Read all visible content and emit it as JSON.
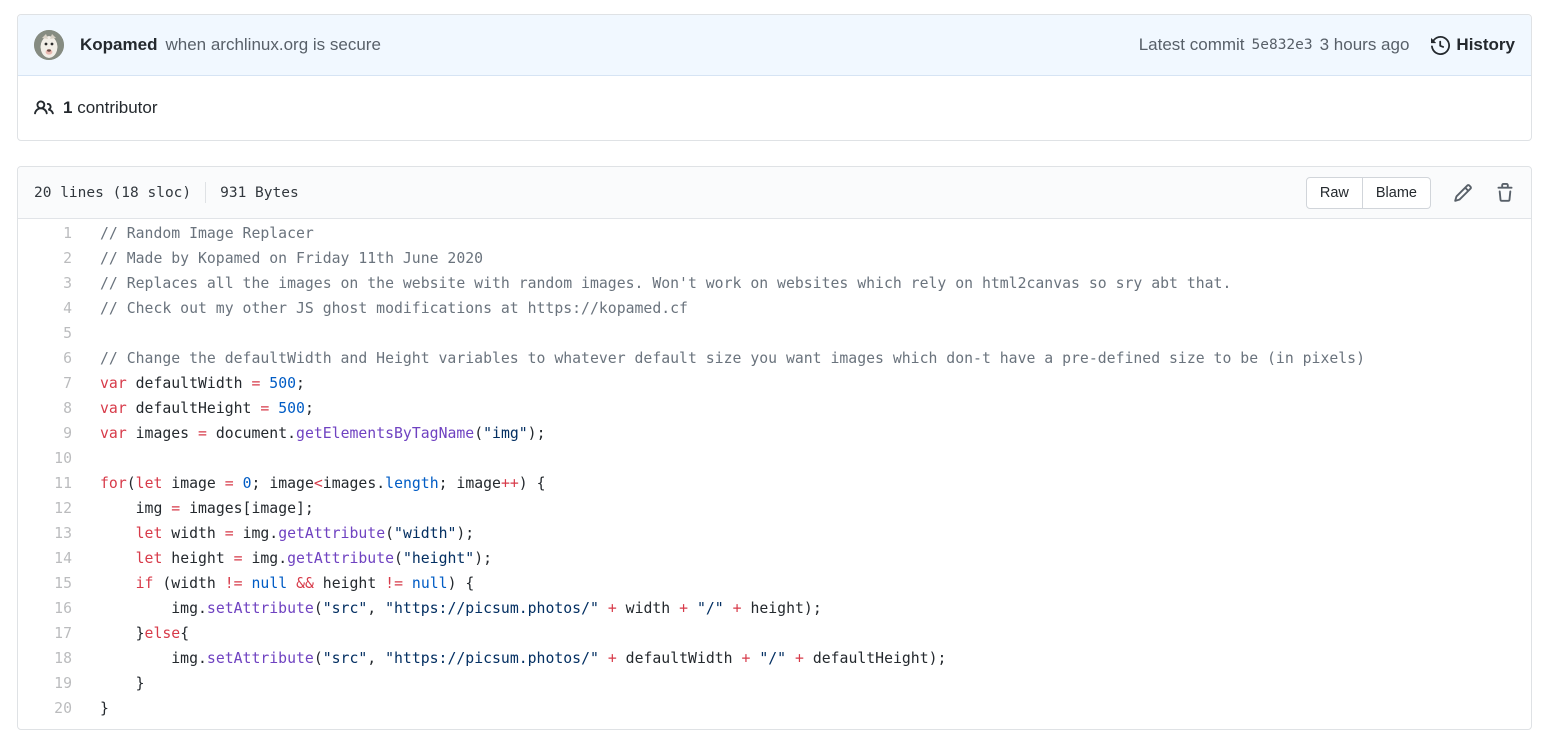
{
  "commit_header": {
    "author": "Kopamed",
    "message": "when archlinux.org is secure",
    "latest_commit_label": "Latest commit",
    "commit_hash": "5e832e3",
    "commit_time": "3 hours ago",
    "history_label": "History"
  },
  "contributors": {
    "count": "1",
    "label": "contributor"
  },
  "file_header": {
    "lines_info": "20 lines (18 sloc)",
    "size_info": "931 Bytes",
    "raw_label": "Raw",
    "blame_label": "Blame"
  },
  "icons": {
    "avatar": "dog-avatar",
    "people": "people-icon",
    "history": "history-clock-icon",
    "edit": "pencil-icon",
    "delete": "trash-icon"
  },
  "colors": {
    "commit_header_bg": "#f1f8ff",
    "file_header_bg": "#fafbfc",
    "border": "#dfe2e5",
    "text": "#24292e",
    "muted": "#586069",
    "syntax_comment": "#6a737d",
    "syntax_keyword": "#d73a49",
    "syntax_constant": "#005cc5",
    "syntax_function": "#6f42c1",
    "syntax_string": "#032f62"
  },
  "code": {
    "lines": [
      {
        "n": 1,
        "t": [
          [
            "// Random Image Replacer",
            "c"
          ]
        ]
      },
      {
        "n": 2,
        "t": [
          [
            "// Made by Kopamed on Friday 11th June 2020",
            "c"
          ]
        ]
      },
      {
        "n": 3,
        "t": [
          [
            "// Replaces all the images on the website with random images. Won't work on websites which rely on html2canvas so sry abt that.",
            "c"
          ]
        ]
      },
      {
        "n": 4,
        "t": [
          [
            "// Check out my other JS ghost modifications at https://kopamed.cf",
            "c"
          ]
        ]
      },
      {
        "n": 5,
        "t": []
      },
      {
        "n": 6,
        "t": [
          [
            "// Change the defaultWidth and Height variables to whatever default size you want images which don-t have a pre-defined size to be (in pixels)",
            "c"
          ]
        ]
      },
      {
        "n": 7,
        "t": [
          [
            "var",
            "k"
          ],
          [
            " defaultWidth ",
            ""
          ],
          [
            "=",
            "k"
          ],
          [
            " ",
            ""
          ],
          [
            "500",
            "n"
          ],
          [
            ";",
            ""
          ]
        ]
      },
      {
        "n": 8,
        "t": [
          [
            "var",
            "k"
          ],
          [
            " defaultHeight ",
            ""
          ],
          [
            "=",
            "k"
          ],
          [
            " ",
            ""
          ],
          [
            "500",
            "n"
          ],
          [
            ";",
            ""
          ]
        ]
      },
      {
        "n": 9,
        "t": [
          [
            "var",
            "k"
          ],
          [
            " images ",
            ""
          ],
          [
            "=",
            "k"
          ],
          [
            " document.",
            ""
          ],
          [
            "getElementsByTagName",
            "f"
          ],
          [
            "(",
            ""
          ],
          [
            "\"img\"",
            "s"
          ],
          [
            ");",
            ""
          ]
        ]
      },
      {
        "n": 10,
        "t": []
      },
      {
        "n": 11,
        "t": [
          [
            "for",
            "k"
          ],
          [
            "(",
            ""
          ],
          [
            "let",
            "k"
          ],
          [
            " image ",
            ""
          ],
          [
            "=",
            "k"
          ],
          [
            " ",
            ""
          ],
          [
            "0",
            "n"
          ],
          [
            "; image",
            ""
          ],
          [
            "<",
            "k"
          ],
          [
            "images.",
            ""
          ],
          [
            "length",
            "n"
          ],
          [
            "; image",
            ""
          ],
          [
            "++",
            "k"
          ],
          [
            ") {",
            ""
          ]
        ]
      },
      {
        "n": 12,
        "t": [
          [
            "    img ",
            ""
          ],
          [
            "=",
            "k"
          ],
          [
            " images[image];",
            ""
          ]
        ]
      },
      {
        "n": 13,
        "t": [
          [
            "    ",
            ""
          ],
          [
            "let",
            "k"
          ],
          [
            " width ",
            ""
          ],
          [
            "=",
            "k"
          ],
          [
            " img.",
            ""
          ],
          [
            "getAttribute",
            "f"
          ],
          [
            "(",
            ""
          ],
          [
            "\"width\"",
            "s"
          ],
          [
            ");",
            ""
          ]
        ]
      },
      {
        "n": 14,
        "t": [
          [
            "    ",
            ""
          ],
          [
            "let",
            "k"
          ],
          [
            " height ",
            ""
          ],
          [
            "=",
            "k"
          ],
          [
            " img.",
            ""
          ],
          [
            "getAttribute",
            "f"
          ],
          [
            "(",
            ""
          ],
          [
            "\"height\"",
            "s"
          ],
          [
            ");",
            ""
          ]
        ]
      },
      {
        "n": 15,
        "t": [
          [
            "    ",
            ""
          ],
          [
            "if",
            "k"
          ],
          [
            " (width ",
            ""
          ],
          [
            "!=",
            "k"
          ],
          [
            " ",
            ""
          ],
          [
            "null",
            "n"
          ],
          [
            " ",
            ""
          ],
          [
            "&&",
            "k"
          ],
          [
            " height ",
            ""
          ],
          [
            "!=",
            "k"
          ],
          [
            " ",
            ""
          ],
          [
            "null",
            "n"
          ],
          [
            ") {",
            ""
          ]
        ]
      },
      {
        "n": 16,
        "t": [
          [
            "        img.",
            ""
          ],
          [
            "setAttribute",
            "f"
          ],
          [
            "(",
            ""
          ],
          [
            "\"src\"",
            "s"
          ],
          [
            ", ",
            ""
          ],
          [
            "\"https://picsum.photos/\"",
            "s"
          ],
          [
            " ",
            ""
          ],
          [
            "+",
            "k"
          ],
          [
            " width ",
            ""
          ],
          [
            "+",
            "k"
          ],
          [
            " ",
            ""
          ],
          [
            "\"/\"",
            "s"
          ],
          [
            " ",
            ""
          ],
          [
            "+",
            "k"
          ],
          [
            " height);",
            ""
          ]
        ]
      },
      {
        "n": 17,
        "t": [
          [
            "    }",
            ""
          ],
          [
            "else",
            "k"
          ],
          [
            "{",
            ""
          ]
        ]
      },
      {
        "n": 18,
        "t": [
          [
            "        img.",
            ""
          ],
          [
            "setAttribute",
            "f"
          ],
          [
            "(",
            ""
          ],
          [
            "\"src\"",
            "s"
          ],
          [
            ", ",
            ""
          ],
          [
            "\"https://picsum.photos/\"",
            "s"
          ],
          [
            " ",
            ""
          ],
          [
            "+",
            "k"
          ],
          [
            " defaultWidth ",
            ""
          ],
          [
            "+",
            "k"
          ],
          [
            " ",
            ""
          ],
          [
            "\"/\"",
            "s"
          ],
          [
            " ",
            ""
          ],
          [
            "+",
            "k"
          ],
          [
            " defaultHeight);",
            ""
          ]
        ]
      },
      {
        "n": 19,
        "t": [
          [
            "    }",
            ""
          ]
        ]
      },
      {
        "n": 20,
        "t": [
          [
            "}",
            ""
          ]
        ]
      }
    ]
  }
}
